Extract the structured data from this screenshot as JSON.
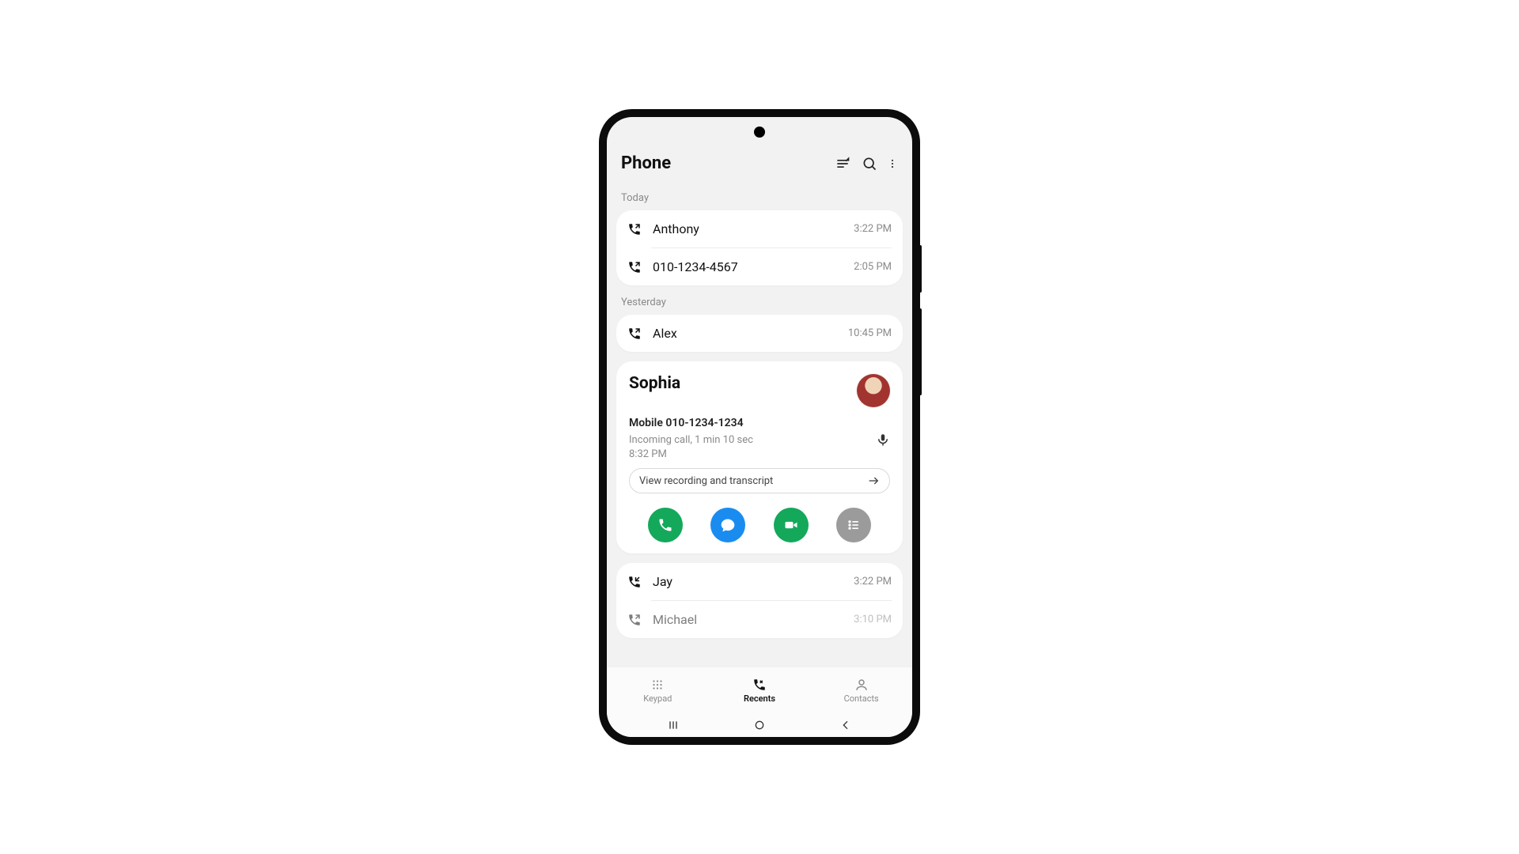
{
  "header": {
    "title": "Phone"
  },
  "sections": {
    "today_label": "Today",
    "yesterday_label": "Yesterday"
  },
  "calls_today": [
    {
      "name": "Anthony",
      "time": "3:22 PM",
      "dir": "out"
    },
    {
      "name": "010-1234-4567",
      "time": "2:05 PM",
      "dir": "out"
    }
  ],
  "calls_yesterday": [
    {
      "name": "Alex",
      "time": "10:45 PM",
      "dir": "out"
    }
  ],
  "expanded": {
    "name": "Sophia",
    "number_line": "Mobile 010-1234-1234",
    "meta": "Incoming call, 1 min 10 sec",
    "time": "8:32 PM",
    "pill_label": "View recording and transcript"
  },
  "calls_below": [
    {
      "name": "Jay",
      "time": "3:22 PM",
      "dir": "in"
    },
    {
      "name": "Michael",
      "time": "3:10 PM",
      "dir": "out"
    }
  ],
  "nav": {
    "keypad": "Keypad",
    "recents": "Recents",
    "contacts": "Contacts"
  }
}
